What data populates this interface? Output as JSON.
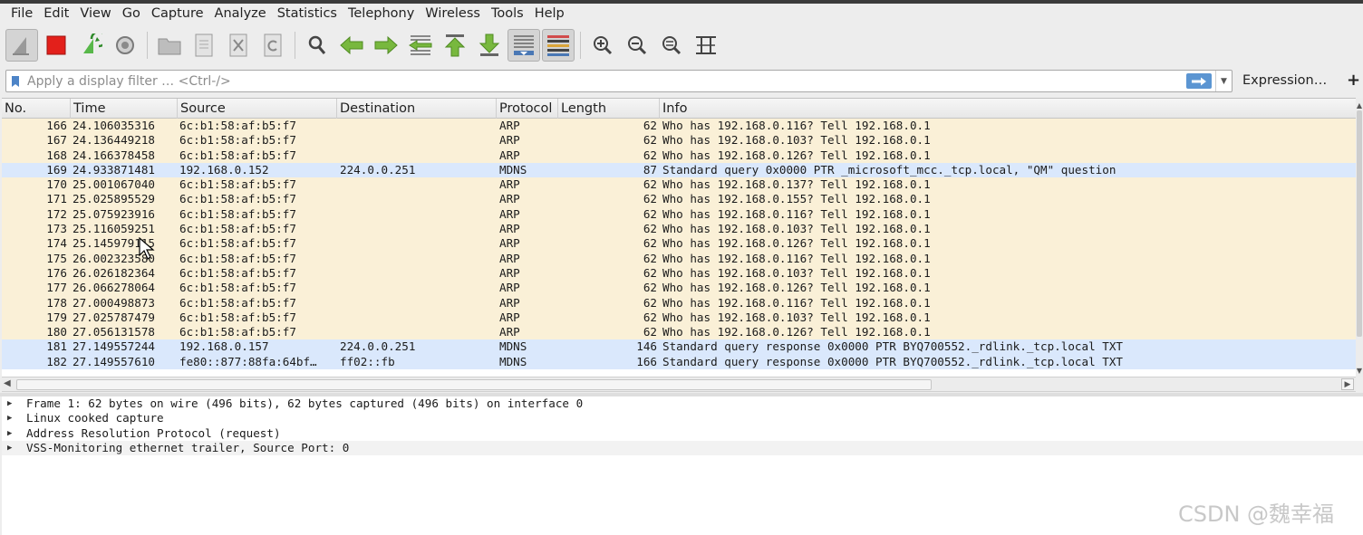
{
  "menu": [
    "File",
    "Edit",
    "View",
    "Go",
    "Capture",
    "Analyze",
    "Statistics",
    "Telephony",
    "Wireless",
    "Tools",
    "Help"
  ],
  "filter": {
    "placeholder": "Apply a display filter … <Ctrl-/>",
    "expression_label": "Expression…",
    "plus_label": "+"
  },
  "columns": [
    "No.",
    "Time",
    "Source",
    "Destination",
    "Protocol",
    "Length",
    "Info"
  ],
  "colors": {
    "arp_row": "#faf0d7",
    "mdns_row": "#dae8fc",
    "apply_button": "#5b95d2",
    "stop_button": "#e3201b"
  },
  "packets": [
    {
      "no": "166",
      "time": "24.106035316",
      "src": "6c:b1:58:af:b5:f7",
      "dst": "",
      "proto": "ARP",
      "len": "62",
      "info": "Who has 192.168.0.116? Tell 192.168.0.1"
    },
    {
      "no": "167",
      "time": "24.136449218",
      "src": "6c:b1:58:af:b5:f7",
      "dst": "",
      "proto": "ARP",
      "len": "62",
      "info": "Who has 192.168.0.103? Tell 192.168.0.1"
    },
    {
      "no": "168",
      "time": "24.166378458",
      "src": "6c:b1:58:af:b5:f7",
      "dst": "",
      "proto": "ARP",
      "len": "62",
      "info": "Who has 192.168.0.126? Tell 192.168.0.1"
    },
    {
      "no": "169",
      "time": "24.933871481",
      "src": "192.168.0.152",
      "dst": "224.0.0.251",
      "proto": "MDNS",
      "len": "87",
      "info": "Standard query 0x0000 PTR _microsoft_mcc._tcp.local, \"QM\" question"
    },
    {
      "no": "170",
      "time": "25.001067040",
      "src": "6c:b1:58:af:b5:f7",
      "dst": "",
      "proto": "ARP",
      "len": "62",
      "info": "Who has 192.168.0.137? Tell 192.168.0.1"
    },
    {
      "no": "171",
      "time": "25.025895529",
      "src": "6c:b1:58:af:b5:f7",
      "dst": "",
      "proto": "ARP",
      "len": "62",
      "info": "Who has 192.168.0.155? Tell 192.168.0.1"
    },
    {
      "no": "172",
      "time": "25.075923916",
      "src": "6c:b1:58:af:b5:f7",
      "dst": "",
      "proto": "ARP",
      "len": "62",
      "info": "Who has 192.168.0.116? Tell 192.168.0.1"
    },
    {
      "no": "173",
      "time": "25.116059251",
      "src": "6c:b1:58:af:b5:f7",
      "dst": "",
      "proto": "ARP",
      "len": "62",
      "info": "Who has 192.168.0.103? Tell 192.168.0.1"
    },
    {
      "no": "174",
      "time": "25.145979115",
      "src": "6c:b1:58:af:b5:f7",
      "dst": "",
      "proto": "ARP",
      "len": "62",
      "info": "Who has 192.168.0.126? Tell 192.168.0.1"
    },
    {
      "no": "175",
      "time": "26.002323580",
      "src": "6c:b1:58:af:b5:f7",
      "dst": "",
      "proto": "ARP",
      "len": "62",
      "info": "Who has 192.168.0.116? Tell 192.168.0.1"
    },
    {
      "no": "176",
      "time": "26.026182364",
      "src": "6c:b1:58:af:b5:f7",
      "dst": "",
      "proto": "ARP",
      "len": "62",
      "info": "Who has 192.168.0.103? Tell 192.168.0.1"
    },
    {
      "no": "177",
      "time": "26.066278064",
      "src": "6c:b1:58:af:b5:f7",
      "dst": "",
      "proto": "ARP",
      "len": "62",
      "info": "Who has 192.168.0.126? Tell 192.168.0.1"
    },
    {
      "no": "178",
      "time": "27.000498873",
      "src": "6c:b1:58:af:b5:f7",
      "dst": "",
      "proto": "ARP",
      "len": "62",
      "info": "Who has 192.168.0.116? Tell 192.168.0.1"
    },
    {
      "no": "179",
      "time": "27.025787479",
      "src": "6c:b1:58:af:b5:f7",
      "dst": "",
      "proto": "ARP",
      "len": "62",
      "info": "Who has 192.168.0.103? Tell 192.168.0.1"
    },
    {
      "no": "180",
      "time": "27.056131578",
      "src": "6c:b1:58:af:b5:f7",
      "dst": "",
      "proto": "ARP",
      "len": "62",
      "info": "Who has 192.168.0.126? Tell 192.168.0.1"
    },
    {
      "no": "181",
      "time": "27.149557244",
      "src": "192.168.0.157",
      "dst": "224.0.0.251",
      "proto": "MDNS",
      "len": "146",
      "info": "Standard query response 0x0000 PTR BYQ700552._rdlink._tcp.local TXT"
    },
    {
      "no": "182",
      "time": "27.149557610",
      "src": "fe80::877:88fa:64bf…",
      "dst": "ff02::fb",
      "proto": "MDNS",
      "len": "166",
      "info": "Standard query response 0x0000 PTR BYQ700552._rdlink._tcp.local TXT"
    }
  ],
  "details": [
    "Frame 1: 62 bytes on wire (496 bits), 62 bytes captured (496 bits) on interface 0",
    "Linux cooked capture",
    "Address Resolution Protocol (request)",
    "VSS-Monitoring ethernet trailer, Source Port: 0"
  ],
  "watermark": "CSDN @魏幸福"
}
